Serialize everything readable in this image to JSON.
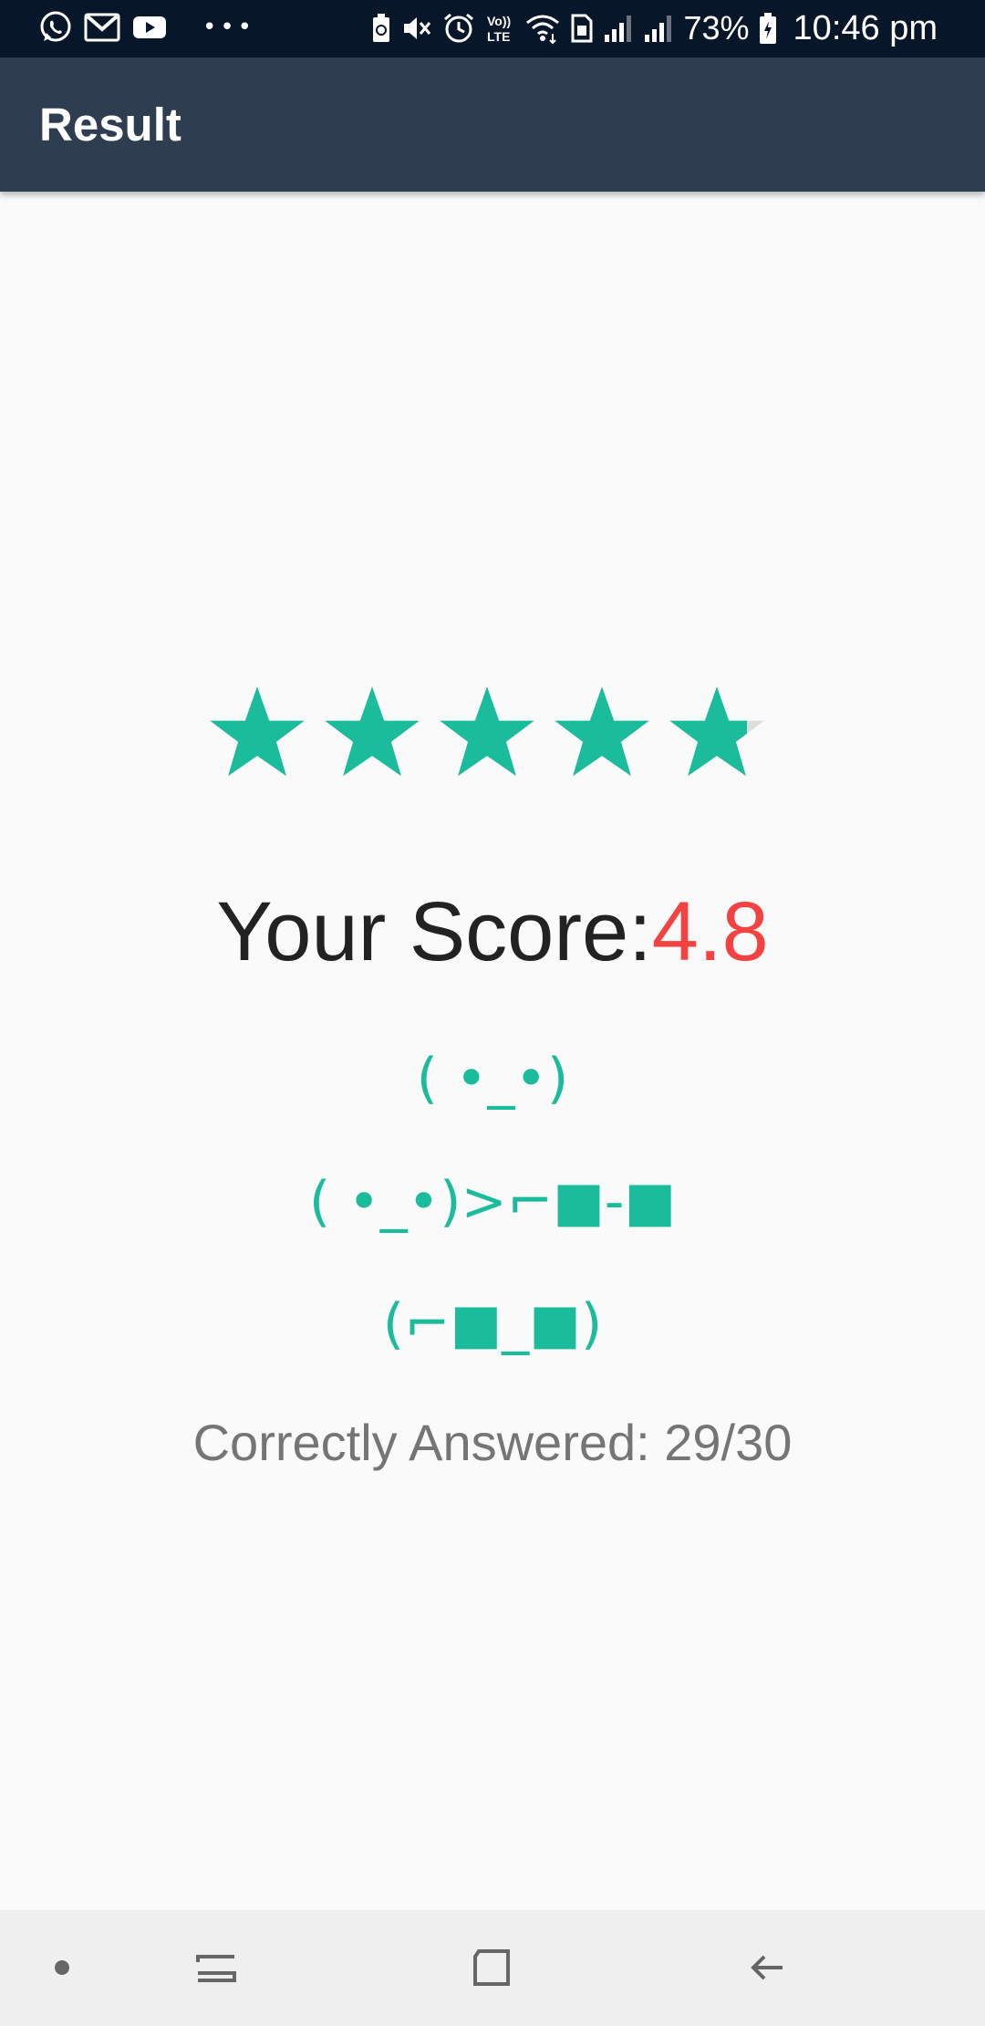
{
  "status_bar": {
    "notification_icons": [
      "whatsapp-icon",
      "gmail-icon",
      "youtube-icon",
      "more-notifications-icon"
    ],
    "system_icons": [
      "battery-saver-icon",
      "mute-icon",
      "alarm-icon",
      "volte-icon",
      "wifi-icon",
      "sim-icon",
      "signal-1-icon",
      "signal-2-icon",
      "battery-charging-icon"
    ],
    "volte_text": "Vo)) LTE",
    "battery_percent": "73%",
    "time": "10:46 pm"
  },
  "app_bar": {
    "title": "Result",
    "background": "#2e3d50"
  },
  "rating": {
    "value": 4.8,
    "max": 5,
    "star_color": "#1abc9c",
    "empty_color": "#dddddd"
  },
  "score": {
    "label": "Your Score:",
    "value": "4.8",
    "value_color": "#f44242"
  },
  "emoticons": {
    "line1": "( •_•)",
    "line2": "( •_•)>⌐■-■",
    "line3": "(⌐■_■)",
    "color": "#1abc9c"
  },
  "result": {
    "correctly_answered": "Correctly Answered: 29/30"
  },
  "navigation": {
    "buttons": [
      "nav-dot-icon",
      "recent-apps-icon",
      "home-icon",
      "back-icon"
    ]
  }
}
